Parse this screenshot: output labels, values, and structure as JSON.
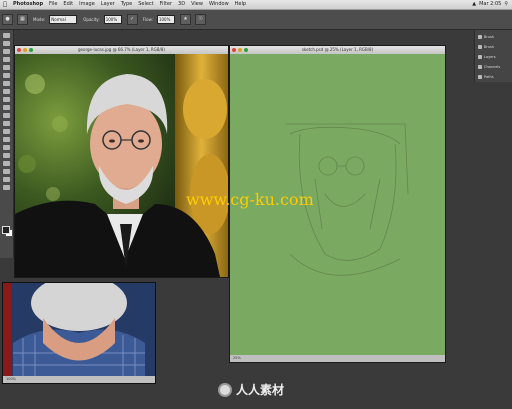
{
  "menubar": {
    "app": "Photoshop",
    "items": [
      "File",
      "Edit",
      "Image",
      "Layer",
      "Type",
      "Select",
      "Filter",
      "3D",
      "View",
      "Window",
      "Help"
    ],
    "clock": "Mar 2:05"
  },
  "options": {
    "mode_label": "Mode:",
    "mode_value": "Normal",
    "opacity_label": "Opacity:",
    "opacity_value": "100%",
    "flow_label": "Flow:",
    "flow_value": "100%"
  },
  "right_panel": {
    "items": [
      "Brush",
      "Brush",
      "Layers",
      "Channels",
      "Paths"
    ]
  },
  "windows": {
    "photo_title": "george-lucas.jpg @ 66.7% (Layer 1, RGB/8)",
    "sketch_title": "sketch.psd @ 25% (Layer 1, RGB/8)",
    "sketch_status": "25%",
    "crop_status": "100%"
  },
  "watermark": {
    "site": "www.cg-ku.com",
    "logo": "人人素材"
  },
  "colors": {
    "canvas_green": "#7aa962",
    "app_bg": "#3a3a3a"
  }
}
